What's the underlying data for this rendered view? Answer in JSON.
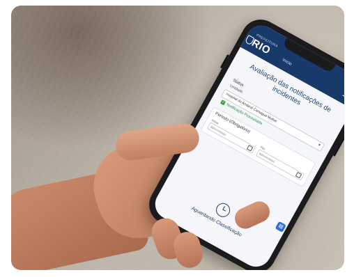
{
  "photo": {
    "description_icons": [
      "hand",
      "smartphone"
    ]
  },
  "app": {
    "logo_subtitle": "PREFEITURA",
    "logo_text": "RIO",
    "nav_label": "Início",
    "menu_icon": "hamburger-icon",
    "page_title": "Avaliação das notificações de incidentes",
    "fields": {
      "status_label": "Status",
      "unit_label": "Unidade",
      "select_value": "Hospital do Andaraí Caniagua Mulher",
      "status_value": "Notificação Processada"
    },
    "filter_card": {
      "title": "Período (Obrigatório)",
      "start_label": "Início",
      "end_label": "Fim",
      "start_placeholder": "dd/mm/aaaa",
      "end_placeholder": "dd/mm/aaaa"
    },
    "waiting_text": "Aguardando Classificação",
    "fab_icon": "chat-icon"
  }
}
